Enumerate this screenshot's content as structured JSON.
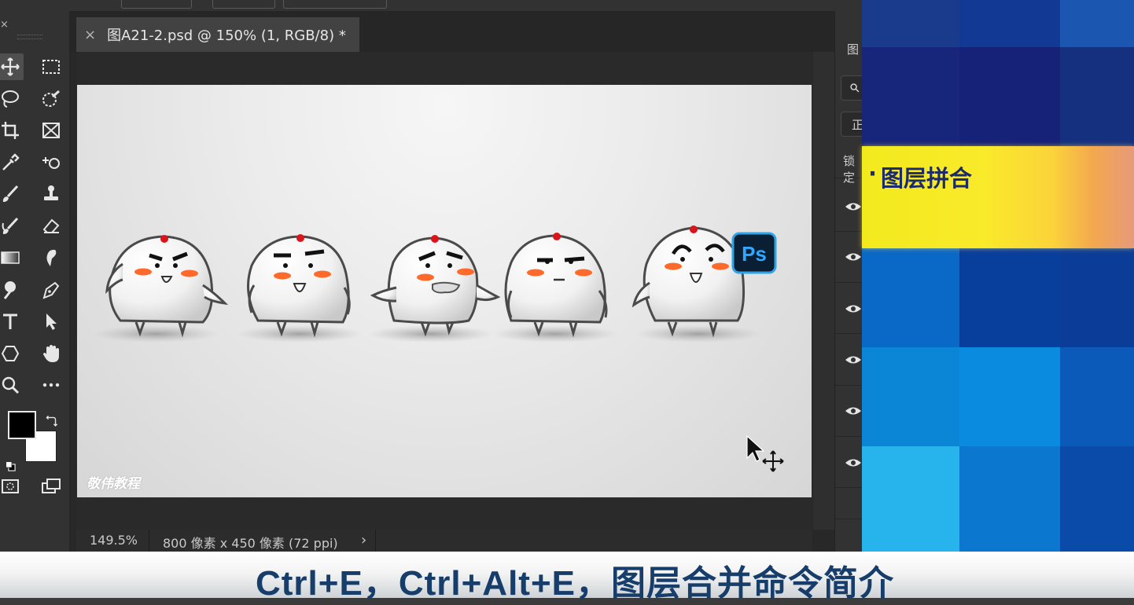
{
  "document": {
    "tab_title": "图A21-2.psd @ 150% (1, RGB/8) *",
    "close_glyph": "×"
  },
  "status": {
    "zoom": "149.5%",
    "doc_info": "800 像素 x 450 像素 (72 ppi)",
    "arrow": "›"
  },
  "canvas": {
    "watermark": "敬伟教程",
    "ps_badge": "Ps"
  },
  "layers_panel": {
    "title_partial": "图",
    "mode_partial": "正",
    "lock_partial": "锁定"
  },
  "banner": {
    "bullet": "·",
    "text": "图层拼合"
  },
  "caption": "Ctrl+E，Ctrl+Alt+E，图层合并命令简介",
  "tools": [
    "move-tool-icon",
    "marquee-tool-icon",
    "lasso-tool-icon",
    "quick-selection-tool-icon",
    "crop-tool-icon",
    "frame-tool-icon",
    "eyedropper-tool-icon",
    "spot-healing-tool-icon",
    "brush-tool-icon",
    "stamp-tool-icon",
    "history-brush-tool-icon",
    "eraser-tool-icon",
    "gradient-tool-icon",
    "blur-tool-icon",
    "dodge-tool-icon",
    "pen-tool-icon",
    "type-tool-icon",
    "path-selection-tool-icon",
    "shape-tool-icon",
    "hand-tool-icon",
    "zoom-tool-icon",
    "more-tools-icon"
  ],
  "colors": {
    "foreground": "#000000",
    "background": "#ffffff",
    "caption_text": "#173d6b",
    "banner_text": "#1c2a6e"
  }
}
